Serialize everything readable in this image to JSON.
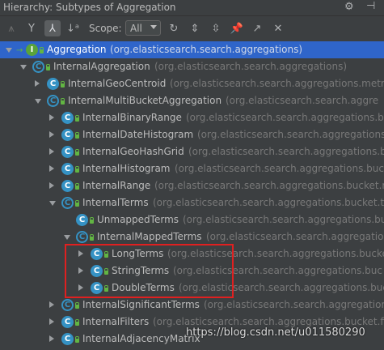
{
  "window": {
    "title": "Hierarchy:  Subtypes of Aggregation",
    "gear_icon": "gear-icon",
    "hide_icon": "hide-panel-icon"
  },
  "toolbar": {
    "buttons": [
      {
        "name": "supertypes-hierarchy-button",
        "glyph": "⩚",
        "state": "disabled"
      },
      {
        "name": "class-hierarchy-button",
        "glyph": "Y",
        "state": "normal"
      },
      {
        "name": "subtypes-hierarchy-button",
        "glyph": "⅄",
        "state": "active"
      },
      {
        "name": "sort-alphabetically-button",
        "glyph": "↓ᵃ",
        "state": "normal"
      }
    ],
    "scope_label": "Scope:",
    "scope_value": "All",
    "right_buttons": [
      {
        "name": "refresh-button",
        "glyph": "↻"
      },
      {
        "name": "expand-all-button",
        "glyph": "⇕"
      },
      {
        "name": "collapse-all-button",
        "glyph": "⇳"
      },
      {
        "name": "pin-button",
        "glyph": "📌"
      },
      {
        "name": "open-in-editor-button",
        "glyph": "↗"
      },
      {
        "name": "close-button",
        "glyph": "✕"
      }
    ]
  },
  "tree": [
    {
      "name": "Aggregation",
      "pkg": "(org.elasticsearch.search.aggregations)",
      "depth": 0,
      "expander": "down",
      "kind": "interface",
      "selected": true
    },
    {
      "name": "InternalAggregation",
      "pkg": "(org.elasticsearch.search.aggregations)",
      "depth": 1,
      "expander": "down",
      "kind": "abstract",
      "selected": false
    },
    {
      "name": "InternalGeoCentroid",
      "pkg": "(org.elasticsearch.search.aggregations.metrics",
      "depth": 2,
      "expander": "right",
      "kind": "class",
      "selected": false
    },
    {
      "name": "InternalMultiBucketAggregation",
      "pkg": "(org.elasticsearch.search.aggre",
      "depth": 2,
      "expander": "down",
      "kind": "abstract",
      "selected": false
    },
    {
      "name": "InternalBinaryRange",
      "pkg": "(org.elasticsearch.search.aggregations.buc",
      "depth": 3,
      "expander": "right",
      "kind": "class",
      "selected": false
    },
    {
      "name": "InternalDateHistogram",
      "pkg": "(org.elasticsearch.search.aggregations.buc",
      "depth": 3,
      "expander": "right",
      "kind": "class",
      "selected": false
    },
    {
      "name": "InternalGeoHashGrid",
      "pkg": "(org.elasticsearch.search.aggregations.buck",
      "depth": 3,
      "expander": "right",
      "kind": "class",
      "selected": false
    },
    {
      "name": "InternalHistogram",
      "pkg": "(org.elasticsearch.search.aggregations.bucke",
      "depth": 3,
      "expander": "right",
      "kind": "class",
      "selected": false
    },
    {
      "name": "InternalRange",
      "pkg": "(org.elasticsearch.search.aggregations.bucket.ra",
      "depth": 3,
      "expander": "right",
      "kind": "class",
      "selected": false
    },
    {
      "name": "InternalTerms",
      "pkg": "(org.elasticsearch.search.aggregations.bucket.te",
      "depth": 3,
      "expander": "down",
      "kind": "abstract",
      "selected": false
    },
    {
      "name": "UnmappedTerms",
      "pkg": "(org.elasticsearch.search.aggregations.bucke",
      "depth": 4,
      "expander": "none",
      "kind": "class",
      "selected": false
    },
    {
      "name": "InternalMappedTerms",
      "pkg": "(org.elasticsearch.search.aggregation",
      "depth": 4,
      "expander": "down",
      "kind": "abstract",
      "selected": false
    },
    {
      "name": "LongTerms",
      "pkg": "(org.elasticsearch.search.aggregations.bucke",
      "depth": 5,
      "expander": "right",
      "kind": "class",
      "selected": false
    },
    {
      "name": "StringTerms",
      "pkg": "(org.elasticsearch.search.aggregations.buc",
      "depth": 5,
      "expander": "right",
      "kind": "class",
      "selected": false
    },
    {
      "name": "DoubleTerms",
      "pkg": "(org.elasticsearch.search.aggregations.buc",
      "depth": 5,
      "expander": "right",
      "kind": "class",
      "selected": false
    },
    {
      "name": "InternalSignificantTerms",
      "pkg": "(org.elasticsearch.search.aggregations.b",
      "depth": 3,
      "expander": "right",
      "kind": "abstract",
      "selected": false
    },
    {
      "name": "InternalFilters",
      "pkg": "(org.elasticsearch.search.aggregations.bucket.fi",
      "depth": 3,
      "expander": "right",
      "kind": "class",
      "selected": false
    },
    {
      "name": "InternalAdjacencyMatrix",
      "pkg": "",
      "depth": 3,
      "expander": "right",
      "kind": "class",
      "selected": false
    }
  ],
  "watermark": "https://blog.csdn.net/u011580290",
  "colors": {
    "background": "#3c3f41",
    "selection": "#2f65ca",
    "class_icon": "#3592c4",
    "lock_green": "#62b543",
    "annotation_red": "#e02020"
  }
}
